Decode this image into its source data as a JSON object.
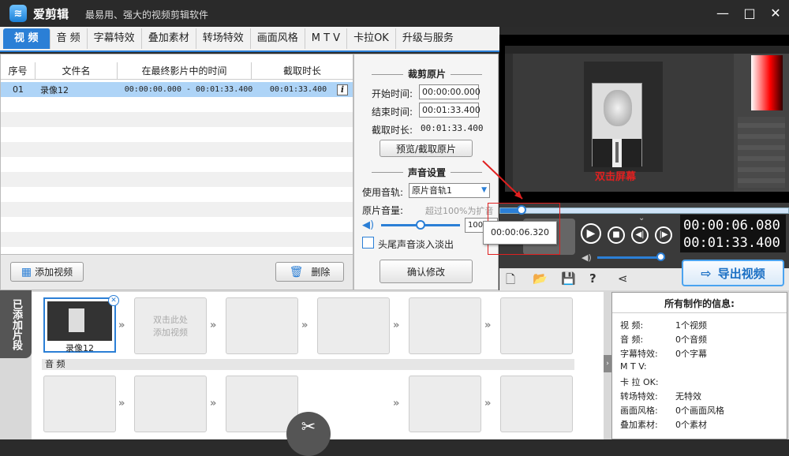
{
  "app": {
    "name": "爱剪辑",
    "slogan": "最易用、强大的视频剪辑软件",
    "logo_glyph": "≋"
  },
  "window": {
    "minimize": "—",
    "maximize": "□",
    "close": "✕"
  },
  "tabs": [
    "视 频",
    "音 频",
    "字幕特效",
    "叠加素材",
    "转场特效",
    "画面风格",
    "M T V",
    "卡拉OK",
    "升级与服务"
  ],
  "table": {
    "headers": [
      "序号",
      "文件名",
      "在最终影片中的时间",
      "截取时长"
    ],
    "rows": [
      {
        "index": "01",
        "name": "录像12",
        "time": "00:00:00.000 - 00:01:33.400",
        "duration": "00:01:33.400"
      }
    ]
  },
  "left_buttons": {
    "add": "添加视频",
    "delete": "删除"
  },
  "crop": {
    "title": "裁剪原片",
    "start_label": "开始时间:",
    "start_value": "00:00:00.000",
    "end_label": "结束时间:",
    "end_value": "00:01:33.400",
    "dur_label": "截取时长:",
    "dur_value": "00:01:33.400",
    "preview_btn": "预览/截取原片"
  },
  "sound": {
    "title": "声音设置",
    "track_label": "使用音轨:",
    "track_value": "原片音轨1",
    "volume_label": "原片音量:",
    "volume_hint": "超过100%为扩音",
    "volume_value": "100%",
    "fade_label": "头尾声音淡入淡出",
    "confirm": "确认修改"
  },
  "preview": {
    "overlay_text": "双击屏幕",
    "tooltip": "00:00:06.320",
    "current_time": "00:00:06.080",
    "total_time": "00:01:33.400",
    "progress": 0.07
  },
  "export": {
    "label": "导出视频"
  },
  "timeline": {
    "side_label": "已添加片段",
    "clip_name": "录像12",
    "add_hint_1": "双击此处",
    "add_hint_2": "添加视频",
    "audio_label": "音 频"
  },
  "info": {
    "title": "所有制作的信息:",
    "rows": [
      {
        "k": "视    频:",
        "v": "1个视频"
      },
      {
        "k": "音    频:",
        "v": "0个音频"
      },
      {
        "k": "字幕特效:",
        "v": "0个字幕"
      },
      {
        "k": "M  T  V:",
        "v": ""
      },
      {
        "k": "卡 拉 OK:",
        "v": ""
      },
      {
        "k": "转场特效:",
        "v": "无特效"
      },
      {
        "k": "画面风格:",
        "v": "0个画面风格"
      },
      {
        "k": "叠加素材:",
        "v": "0个素材"
      }
    ]
  },
  "icons": [
    "new-project-icon",
    "open-folder-icon",
    "save-icon",
    "help-icon",
    "share-icon",
    "scissors-icon",
    "info-icon",
    "film-add-icon",
    "trash-icon",
    "speaker-icon"
  ],
  "colors": {
    "accent": "#2b7fd6",
    "highlight_row": "#aed4f7",
    "red": "#e02020"
  }
}
